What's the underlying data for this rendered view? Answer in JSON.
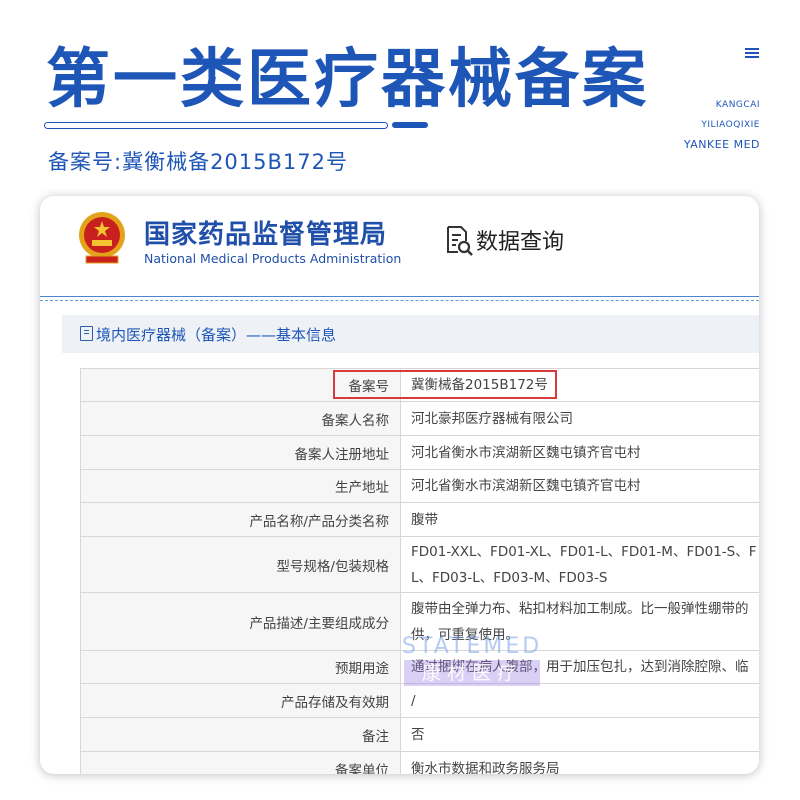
{
  "header": {
    "title": "第一类医疗器械备案",
    "filing_number": "备案号:冀衡械备2015B172号",
    "brand_lines": [
      "KANGCAI",
      "YILIAOQIXIE",
      "YANKEE MED"
    ]
  },
  "agency": {
    "name_cn": "国家药品监督管理局",
    "name_en": "National Medical Products Administration",
    "query_label": "数据查询"
  },
  "section": {
    "title": "境内医疗器械（备案）——基本信息"
  },
  "table": {
    "rows": [
      {
        "label": "备案号",
        "value": [
          "冀衡械备2015B172号"
        ]
      },
      {
        "label": "备案人名称",
        "value": [
          "河北豪邦医疗器械有限公司"
        ]
      },
      {
        "label": "备案人注册地址",
        "value": [
          "河北省衡水市滨湖新区魏屯镇齐官屯村"
        ]
      },
      {
        "label": "生产地址",
        "value": [
          "河北省衡水市滨湖新区魏屯镇齐官屯村"
        ]
      },
      {
        "label": "产品名称/产品分类名称",
        "value": [
          "腹带"
        ]
      },
      {
        "label": "型号规格/包装规格",
        "value": [
          "FD01-XXL、FD01-XL、FD01-L、FD01-M、FD01-S、F",
          "L、FD03-L、FD03-M、FD03-S"
        ]
      },
      {
        "label": "产品描述/主要组成成分",
        "value": [
          "腹带由全弹力布、粘扣材料加工制成。比一般弹性绷带的",
          "供，可重复使用。"
        ]
      },
      {
        "label": "预期用途",
        "value": [
          "通过捆绑在病人腹部，用于加压包扎，达到消除腔隙、临"
        ]
      },
      {
        "label": "产品存储及有效期",
        "value": [
          "/"
        ]
      },
      {
        "label": "备注",
        "value": [
          "否"
        ]
      },
      {
        "label": "备案单位",
        "value": [
          "衡水市数据和政务服务局"
        ]
      }
    ]
  },
  "watermark": {
    "en": "STATEMED",
    "cn": "康材医疗"
  },
  "colors": {
    "brand_blue": "#1e56b8",
    "highlight_red": "#d63c3c"
  }
}
